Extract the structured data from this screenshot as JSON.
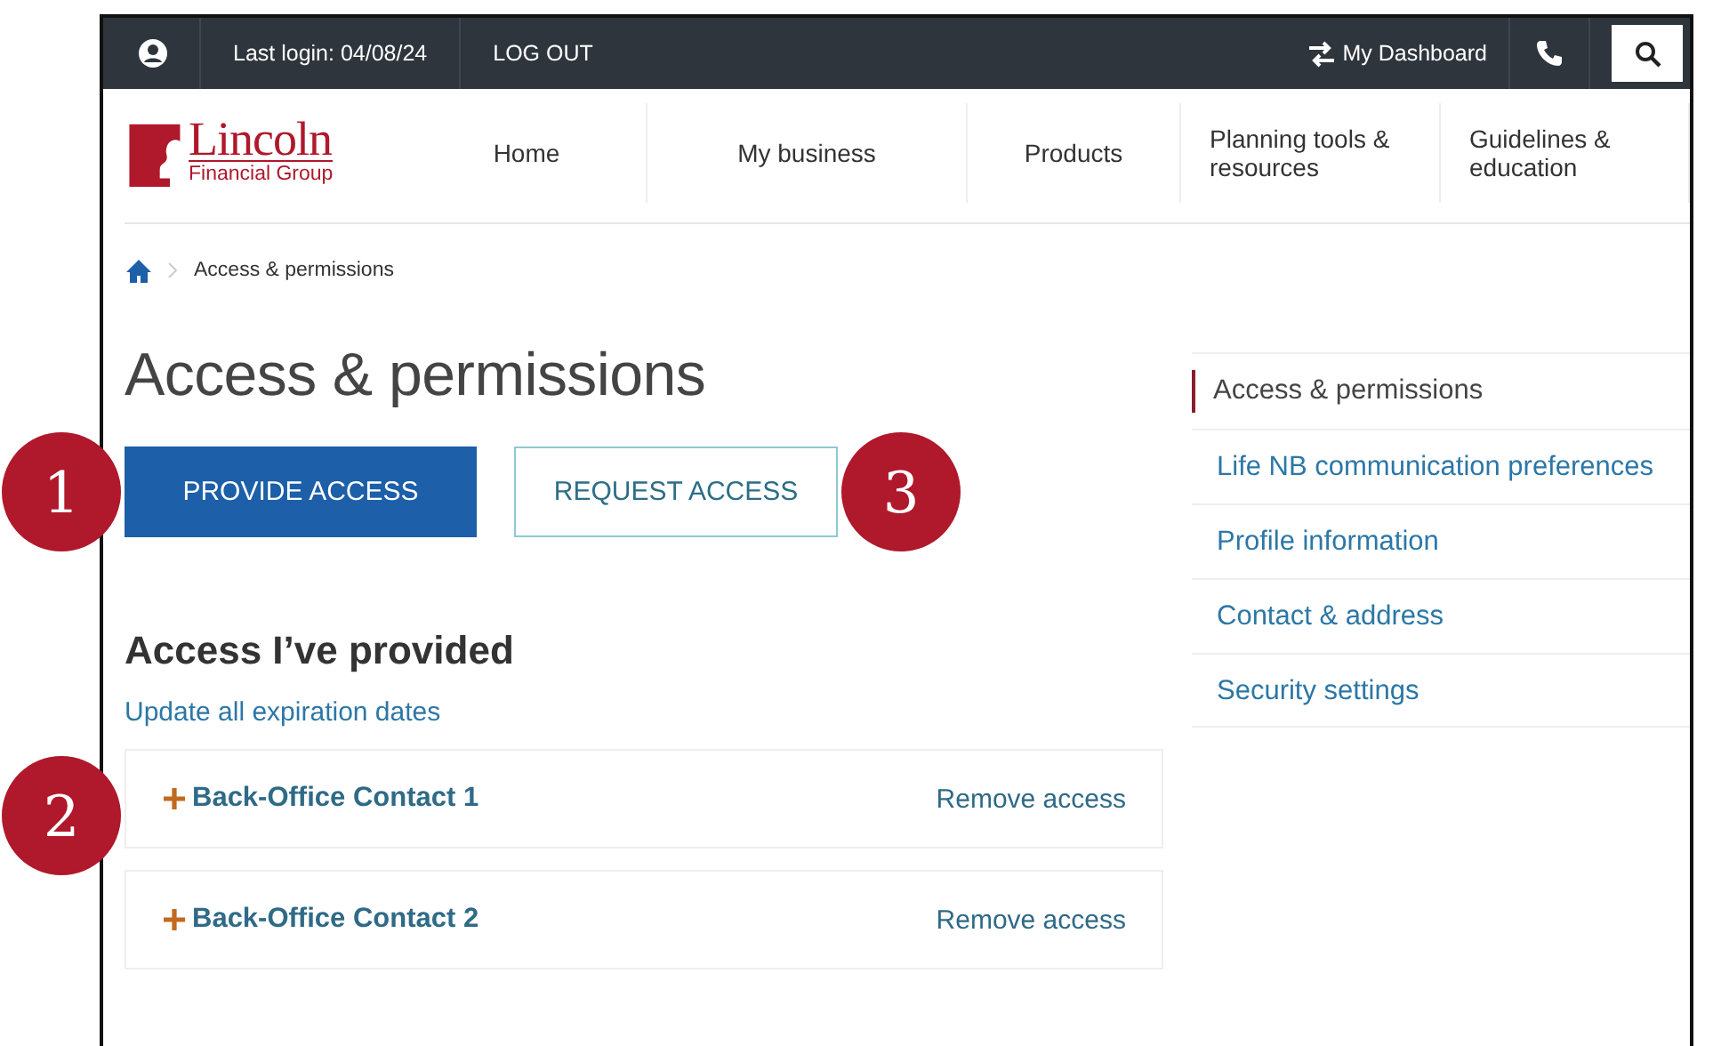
{
  "top_bar": {
    "last_login": "Last login: 04/08/24",
    "logout": "LOG OUT",
    "dashboard": "My Dashboard"
  },
  "logo": {
    "name": "Lincoln",
    "tagline": "Financial Group"
  },
  "nav": [
    {
      "label": "Home"
    },
    {
      "label": "My business"
    },
    {
      "label": "Products"
    },
    {
      "label": "Planning tools & resources"
    },
    {
      "label": "Guidelines & education"
    }
  ],
  "breadcrumb": [
    "Access & permissions"
  ],
  "title": "Access & permissions",
  "buttons": [
    {
      "label": "PROVIDE ACCESS",
      "kind": "primary",
      "callout": "1"
    },
    {
      "label": "REQUEST ACCESS",
      "kind": "secondary",
      "callout": "3"
    }
  ],
  "section": {
    "heading": "Access I’ve provided",
    "link": "Update all expiration dates"
  },
  "contacts": [
    {
      "name": "Back-Office Contact 1",
      "action": "Remove access",
      "callout": "2"
    },
    {
      "name": "Back-Office Contact 2",
      "action": "Remove access"
    }
  ],
  "sidebar": {
    "items": [
      {
        "label": "Access & permissions",
        "selected": true
      },
      {
        "label": "Life NB communication preferences",
        "selected": false
      },
      {
        "label": "Profile information",
        "selected": false
      },
      {
        "label": "Contact & address",
        "selected": false
      },
      {
        "label": "Security settings",
        "selected": false
      }
    ]
  }
}
